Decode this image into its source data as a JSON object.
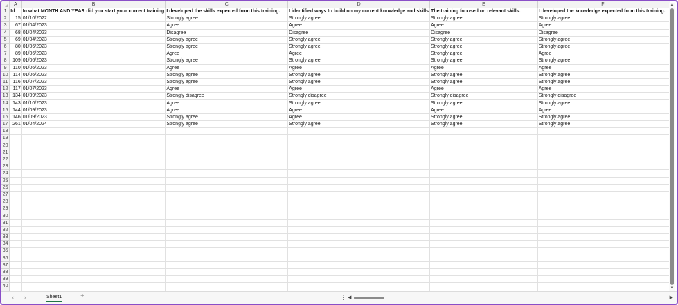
{
  "columns": [
    "A",
    "B",
    "C",
    "D",
    "E",
    "F"
  ],
  "header_row": [
    "Id",
    "In what MONTH AND YEAR did you start your current training",
    "I developed the skills expected from this training.",
    "I identified ways to build on my current knowledge and skills",
    "The training focused on relevant skills.",
    "I developed the knowledge expected from this training."
  ],
  "rows": [
    [
      "15",
      "01/10/2022",
      "Strongly agree",
      "Strongly agree",
      "Strongly agree",
      "Strongly agree"
    ],
    [
      "67",
      "01/04/2023",
      "Agree",
      "Agree",
      "Agree",
      "Agree"
    ],
    [
      "68",
      "01/04/2023",
      "Disagree",
      "Disagree",
      "Disagree",
      "Disagree"
    ],
    [
      "69",
      "01/04/2023",
      "Strongly agree",
      "Strongly agree",
      "Strongly agree",
      "Strongly agree"
    ],
    [
      "80",
      "01/06/2023",
      "Strongly agree",
      "Strongly agree",
      "Strongly agree",
      "Strongly agree"
    ],
    [
      "89",
      "01/06/2023",
      "Agree",
      "Agree",
      "Strongly agree",
      "Agree"
    ],
    [
      "109",
      "01/06/2023",
      "Strongly agree",
      "Strongly agree",
      "Strongly agree",
      "Strongly agree"
    ],
    [
      "110",
      "01/06/2023",
      "Agree",
      "Agree",
      "Agree",
      "Agree"
    ],
    [
      "114",
      "01/06/2023",
      "Strongly agree",
      "Strongly agree",
      "Strongly agree",
      "Strongly agree"
    ],
    [
      "116",
      "01/07/2023",
      "Strongly agree",
      "Strongly agree",
      "Strongly agree",
      "Strongly agree"
    ],
    [
      "117",
      "01/07/2023",
      "Agree",
      "Agree",
      "Agree",
      "Agree"
    ],
    [
      "134",
      "01/09/2023",
      "Strongly disagree",
      "Strongly disagree",
      "Strongly disagree",
      "Strongly disagree"
    ],
    [
      "143",
      "01/10/2023",
      "Agree",
      "Strongly agree",
      "Strongly agree",
      "Strongly agree"
    ],
    [
      "144",
      "01/09/2023",
      "Agree",
      "Agree",
      "Agree",
      "Agree"
    ],
    [
      "146",
      "01/09/2023",
      "Strongly agree",
      "Agree",
      "Strongly agree",
      "Strongly agree"
    ],
    [
      "261",
      "01/04/2024",
      "Strongly agree",
      "Strongly agree",
      "Strongly agree",
      "Strongly agree"
    ]
  ],
  "total_visible_rows": 40,
  "sheet_tab": "Sheet1",
  "add_sheet_label": "+",
  "nav_prev": "‹",
  "nav_next": "›",
  "more_dots": "⋮",
  "scroll_left": "◀",
  "scroll_right": "▶",
  "scroll_up": "▲",
  "scroll_down": "▼",
  "colors": {
    "frame": "#8a4fc7",
    "tab_underline": "#217346",
    "header_bg": "#f3f3f3",
    "gridline": "#e1e1e1"
  }
}
